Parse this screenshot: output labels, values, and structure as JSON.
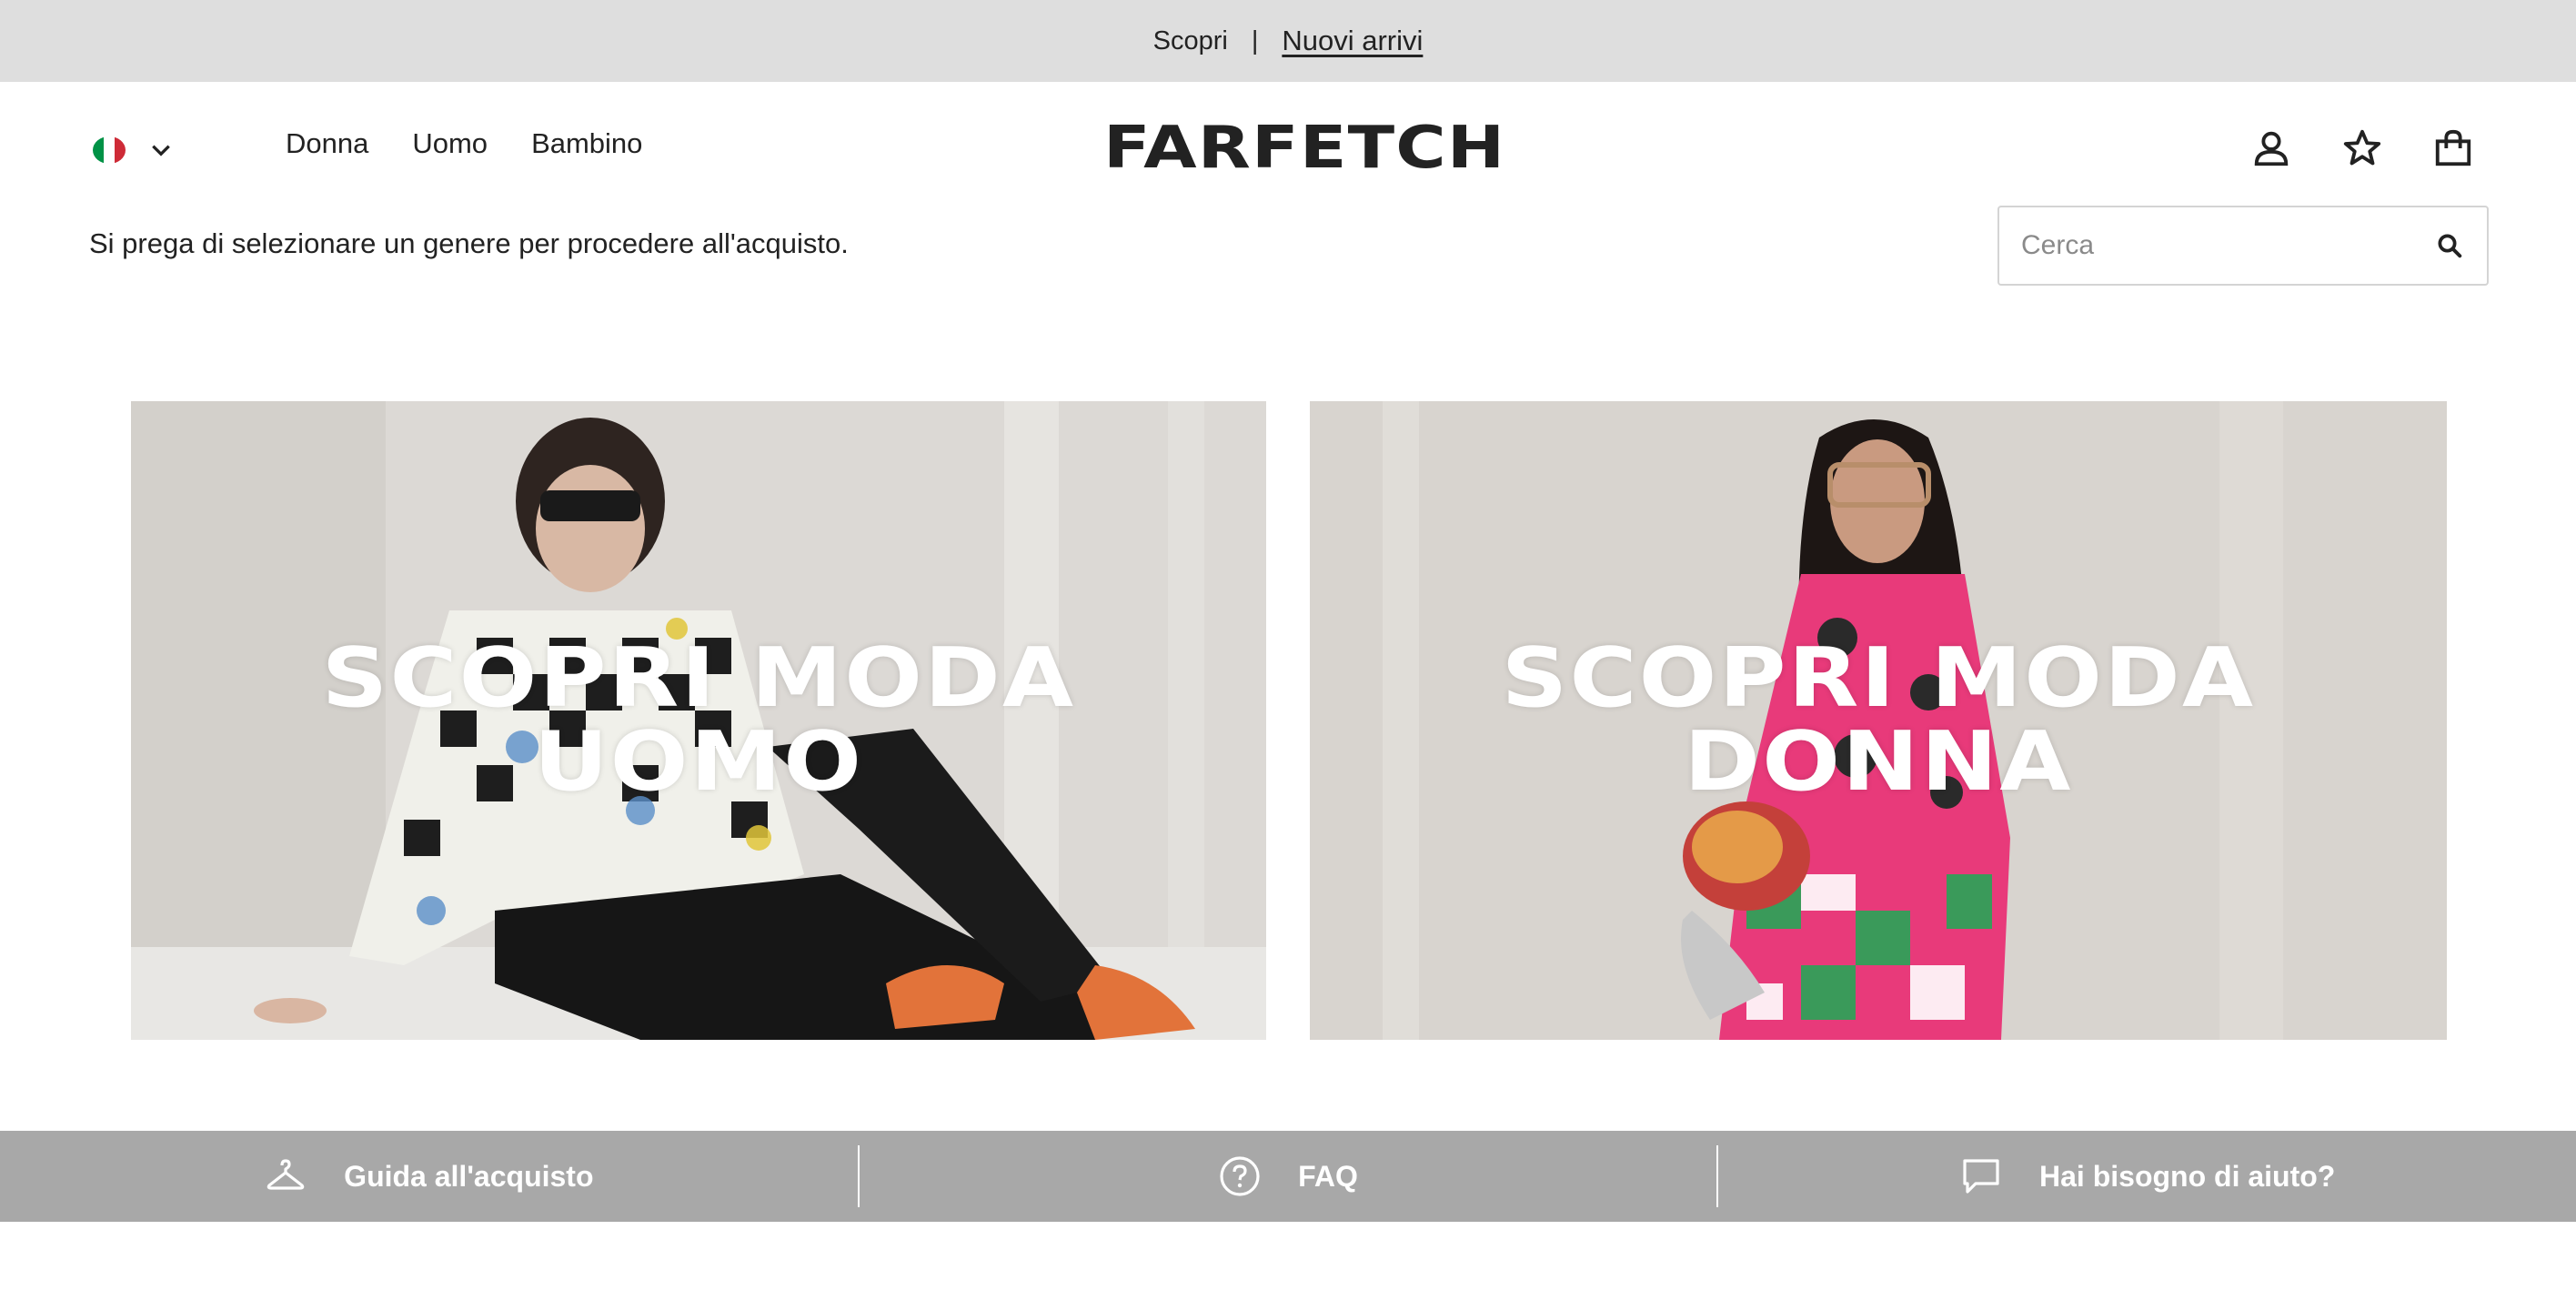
{
  "topbar": {
    "prefix": "Scopri",
    "separator": "|",
    "link": "Nuovi arrivi"
  },
  "header": {
    "flag_colors": [
      "#009246",
      "#ffffff",
      "#ce2b37"
    ],
    "nav": [
      "Donna",
      "Uomo",
      "Bambino"
    ],
    "logo": "FARFETCH",
    "icons": [
      "account-icon",
      "wishlist-star-icon",
      "shopping-bag-icon"
    ],
    "notice": "Si prega di selezionare un genere per procedere all'acquisto.",
    "search": {
      "placeholder": "Cerca",
      "value": ""
    }
  },
  "cards": [
    {
      "line1": "SCOPRI MODA",
      "line2": "UOMO"
    },
    {
      "line1": "SCOPRI MODA",
      "line2": "DONNA"
    }
  ],
  "footer": {
    "items": [
      {
        "label": "Guida all'acquisto",
        "icon": "hanger-icon"
      },
      {
        "label": "FAQ",
        "icon": "question-circle-icon"
      },
      {
        "label": "Hai bisogno di aiuto?",
        "icon": "chat-bubble-icon"
      }
    ]
  }
}
